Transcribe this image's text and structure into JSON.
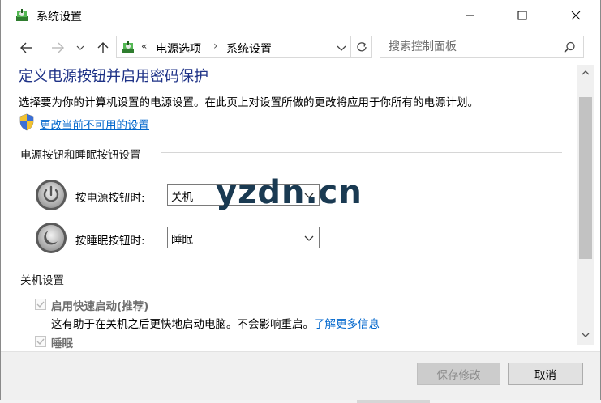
{
  "window": {
    "title": "系统设置",
    "minimize_icon": "minimize-icon",
    "maximize_icon": "maximize-icon",
    "close_icon": "close-icon"
  },
  "address_bar": {
    "chevron": "«",
    "segments": [
      "电源选项",
      "系统设置"
    ],
    "separator": "›"
  },
  "search": {
    "placeholder": "搜索控制面板",
    "value": ""
  },
  "content": {
    "title": "定义电源按钮并启用密码保护",
    "description": "选择要为你的计算机设置的电源设置。在此页上对设置所做的更改将应用于你所有的电源计划。",
    "change_link": "更改当前不可用的设置",
    "section_power": "电源按钮和睡眠按钮设置",
    "power_row": {
      "label": "按电源按钮时:",
      "value": "关机"
    },
    "sleep_row": {
      "label": "按睡眠按钮时:",
      "value": "睡眠"
    },
    "section_shutdown": "关机设置",
    "fast_startup": {
      "label": "启用快速启动(推荐)",
      "checked": true,
      "description": "这有助于在关机之后更快地启动电脑。不会影响重启。",
      "learn_more": "了解更多信息"
    },
    "sleep_option": {
      "label": "睡眠",
      "checked": true
    }
  },
  "watermark": "yzdn.cn",
  "footer": {
    "save_label": "保存修改",
    "cancel_label": "取消"
  },
  "behind_window_glyph": "1",
  "colors": {
    "title_blue": "#1e3287",
    "link_blue": "#0066cc",
    "disabled_text": "#6d6d6d"
  }
}
